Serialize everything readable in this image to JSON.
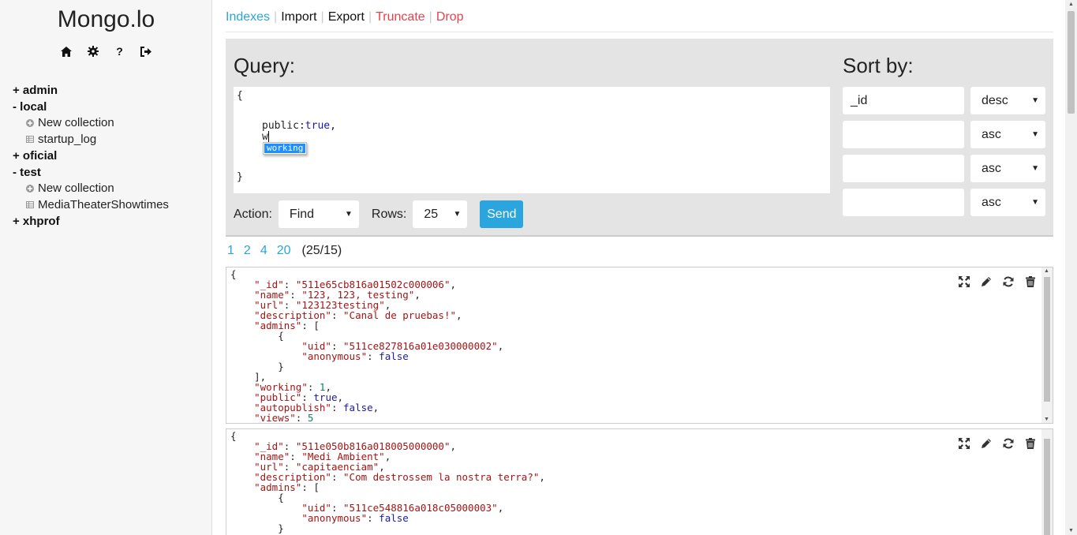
{
  "app": {
    "title": "Mongo.lo"
  },
  "sidebar": {
    "icons": [
      "home-icon",
      "gear-icon",
      "help-icon",
      "logout-icon"
    ],
    "help_glyph": "?",
    "tree": [
      {
        "prefix": "+",
        "name": "admin",
        "collections": []
      },
      {
        "prefix": "-",
        "name": "local",
        "collections": [
          {
            "icon": "plus-circle-icon",
            "label": "New collection"
          },
          {
            "icon": "table-icon",
            "label": "startup_log"
          }
        ]
      },
      {
        "prefix": "+",
        "name": "oficial",
        "collections": []
      },
      {
        "prefix": "-",
        "name": "test",
        "collections": [
          {
            "icon": "plus-circle-icon",
            "label": "New collection"
          },
          {
            "icon": "table-icon",
            "label": "MediaTheaterShowtimes"
          }
        ]
      },
      {
        "prefix": "+",
        "name": "xhprof",
        "collections": []
      }
    ],
    "labels": {
      "admin": "+ admin",
      "local": "- local",
      "local_new": "New collection",
      "local_startup": "startup_log",
      "oficial": "+ oficial",
      "test": "- test",
      "test_new": "New collection",
      "test_media": "MediaTheaterShowtimes",
      "xhprof": "+ xhprof"
    }
  },
  "topnav": {
    "indexes": "Indexes",
    "import": "Import",
    "export": "Export",
    "truncate": "Truncate",
    "drop": "Drop",
    "separator": "|"
  },
  "query": {
    "label": "Query:",
    "lines": [
      "{",
      "public:",
      "true",
      ",",
      "w",
      "}"
    ],
    "autocomplete": "working",
    "action_label": "Action:",
    "action_value": "Find",
    "rows_label": "Rows:",
    "rows_value": "25",
    "send_label": "Send"
  },
  "sort": {
    "label": "Sort by:",
    "rows": [
      {
        "field": "_id",
        "order": "desc"
      },
      {
        "field": "",
        "order": "asc"
      },
      {
        "field": "",
        "order": "asc"
      },
      {
        "field": "",
        "order": "asc"
      }
    ]
  },
  "pager": {
    "pages": [
      "1",
      "2",
      "4",
      "20"
    ],
    "count": "(25/15)"
  },
  "documents": [
    {
      "_id": "511e65cb816a01502c000006",
      "name": "123, 123, testing",
      "url": "123123testing",
      "description": "Canal de pruebas!",
      "admin_uid": "511ce827816a01e030000002",
      "admin_anonymous": "false",
      "working": "1",
      "public": "true",
      "autopublish": "false",
      "views": "5"
    },
    {
      "_id": "511e050b816a018005000000",
      "name": "Medi Ambient",
      "url": "capitaenciam",
      "description": "Com destrossem la nostra terra?",
      "admin_uid": "511ce548816a018c05000003",
      "admin_anonymous": "false"
    }
  ],
  "colors": {
    "accent": "#2aa5dd",
    "danger": "#e8434b",
    "json_key": "#a31515",
    "json_bool": "#1a1aa6",
    "json_number": "#098658"
  }
}
